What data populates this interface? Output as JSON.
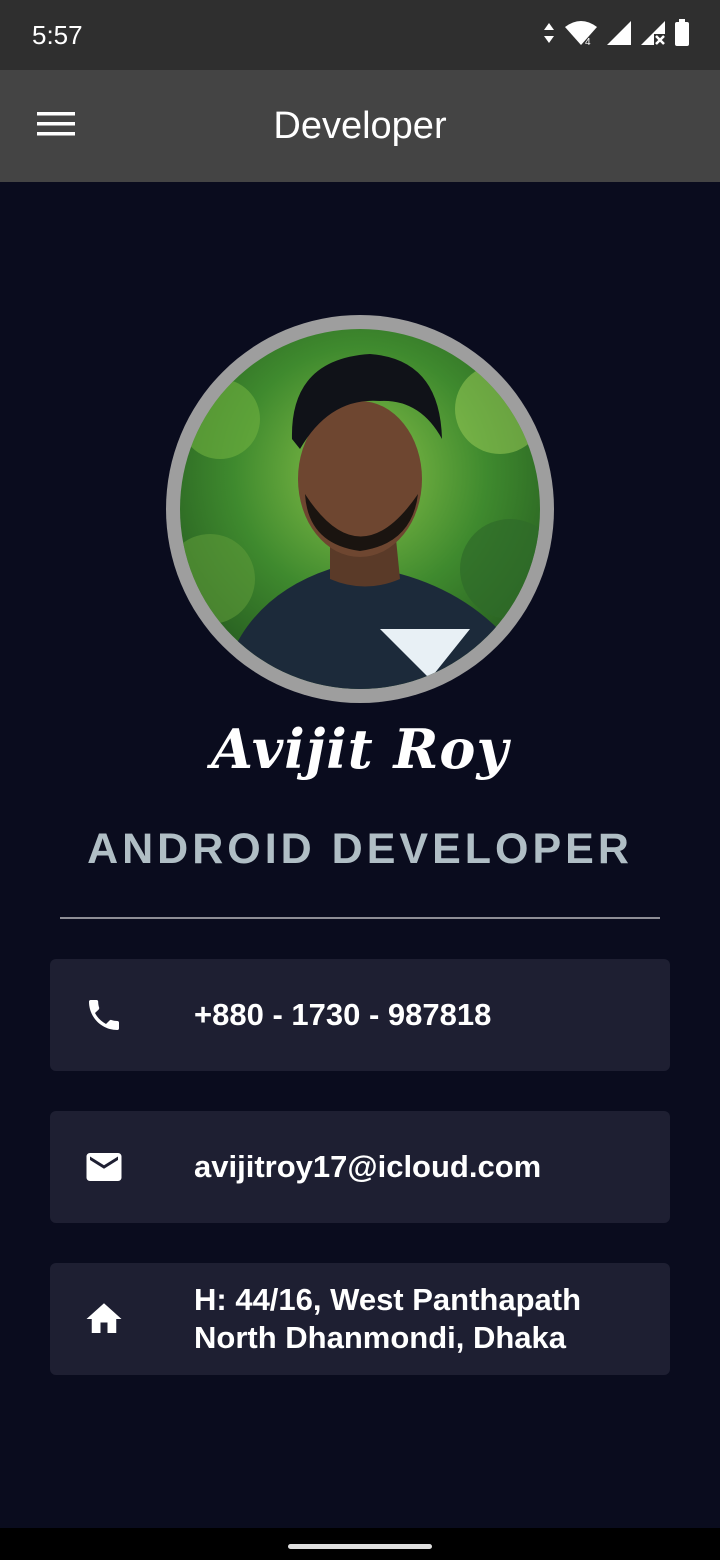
{
  "status_bar": {
    "time": "5:57",
    "icons": [
      "data-arrows-icon",
      "wifi-icon",
      "signal-icon",
      "signal-no-service-icon",
      "battery-icon"
    ]
  },
  "app_bar": {
    "title": "Developer",
    "menu_icon": "hamburger-menu-icon"
  },
  "profile": {
    "name": "Avijit Roy",
    "role": "ANDROID DEVELOPER",
    "avatar_ring_color": "#9e9e9e"
  },
  "contacts": [
    {
      "icon": "phone-icon",
      "lines": [
        "+880 - 1730 - 987818"
      ]
    },
    {
      "icon": "mail-icon",
      "lines": [
        "avijitroy17@icloud.com"
      ]
    },
    {
      "icon": "home-icon",
      "lines": [
        "H: 44/16, West Panthapath",
        "North Dhanmondi, Dhaka"
      ]
    }
  ],
  "colors": {
    "background": "#0a0c1e",
    "app_bar": "#444444",
    "status_bar": "#2f2f2f",
    "card": "#1e1f32",
    "role_text": "#b0bec5"
  }
}
